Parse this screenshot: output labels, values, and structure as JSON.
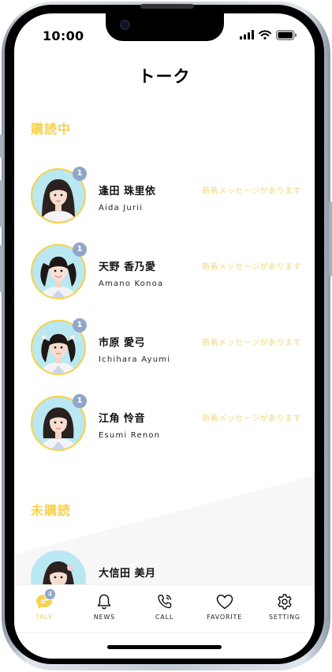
{
  "status": {
    "time": "10:00"
  },
  "header": {
    "title": "トーク"
  },
  "sections": {
    "subscribed": "購読中",
    "unsubscribed": "未購読"
  },
  "subscribed_items": [
    {
      "name_ja": "逢田 珠里依",
      "name_en": "Aida Jurii",
      "unread": "1",
      "message": "新着メッセージがあります",
      "hair": "down"
    },
    {
      "name_ja": "天野 香乃愛",
      "name_en": "Amano Konoa",
      "unread": "1",
      "message": "新着メッセージがあります",
      "hair": "twintails"
    },
    {
      "name_ja": "市原 愛弓",
      "name_en": "Ichihara Ayumi",
      "unread": "1",
      "message": "新着メッセージがあります",
      "hair": "twintails-ribbon"
    },
    {
      "name_ja": "江角 怜音",
      "name_en": "Esumi Renon",
      "unread": "1",
      "message": "新着メッセージがあります",
      "hair": "bob"
    }
  ],
  "unsubscribed_items": [
    {
      "name_ja": "大信田 美月"
    }
  ],
  "tabs": [
    {
      "label": "TALK",
      "icon": "chat-bubble-icon",
      "badge": "4",
      "active": true
    },
    {
      "label": "NEWS",
      "icon": "bell-icon"
    },
    {
      "label": "CALL",
      "icon": "phone-icon"
    },
    {
      "label": "FAVORITE",
      "icon": "heart-icon"
    },
    {
      "label": "SETTING",
      "icon": "gear-icon"
    }
  ],
  "colors": {
    "accent": "#f7d24a",
    "badge": "#8ea7c9",
    "message": "#f3d97a",
    "avatar_bg": "#b9e8f2"
  }
}
